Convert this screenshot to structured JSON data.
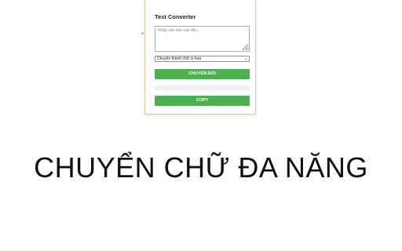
{
  "popup": {
    "title": "Text Converter",
    "textarea_placeholder": "Nhập văn bản vào đây...",
    "select_value": "Chuyển thành chữ in hoa",
    "convert_label": "CHUYỂN ĐỔI",
    "copy_label": "COPY"
  },
  "page": {
    "side_mark": "a",
    "headline": "CHUYỂN CHỮ ĐA NĂNG"
  },
  "colors": {
    "button_green": "#4caf50",
    "popup_border": "#e7c9a8"
  }
}
